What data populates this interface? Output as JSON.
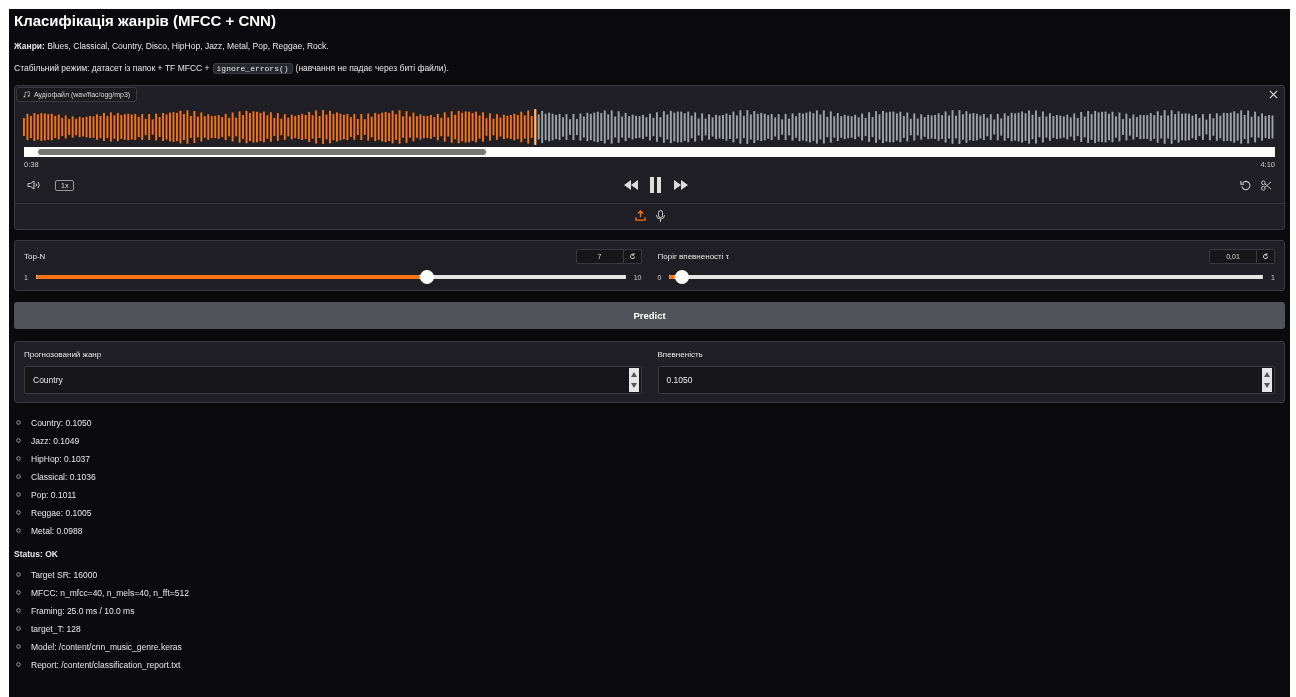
{
  "title": "Класифікація жанрів (MFCC + CNN)",
  "genres_line": "**Жанри:** Blues, Classical, Country, Disco, HipHop, Jazz, Metal, Pop, Reggae, Rock.",
  "mode_line": {
    "before": "Стабільний режим: датасет із папок + TF MFCC +",
    "code": "ignore_errors()",
    "after": "(навчання не падає через биті файли)."
  },
  "audio": {
    "label": "Аудіофайл (wav/flac/ogg/mp3)",
    "waveform": {
      "level": 0.41
    },
    "current_time": "0:38",
    "duration": "4:10",
    "speed": "1x"
  },
  "sliders": [
    {
      "label": "Top-N",
      "value": "7",
      "min": "1",
      "max": "10",
      "level": 0.667
    },
    {
      "label": "Поріг впевненості τ",
      "value": "0,01",
      "min": "0",
      "max": "1",
      "level": 0.01
    }
  ],
  "predict_button": "Predict",
  "outputs": [
    {
      "label": "Прогнозований жанр",
      "value": "Country"
    },
    {
      "label": "Впевненість",
      "value": "0.1050"
    }
  ],
  "scores": [
    "Country: 0.1050",
    "Jazz: 0.1049",
    "HipHop: 0.1037",
    "Classical: 0.1036",
    "Pop: 0.1011",
    "Reggae: 0.1005",
    "Metal: 0.0988"
  ],
  "status": {
    "heading": "Status: OK",
    "items": [
      "Target SR: 16000",
      "MFCC: n_mfcc=40, n_mels=40, n_fft=512",
      "Framing: 25.0 ms / 10.0 ms",
      "target_T: 128",
      "Model: /content/cnn_music_genre.keras",
      "Report: /content/classification_report.txt"
    ]
  }
}
